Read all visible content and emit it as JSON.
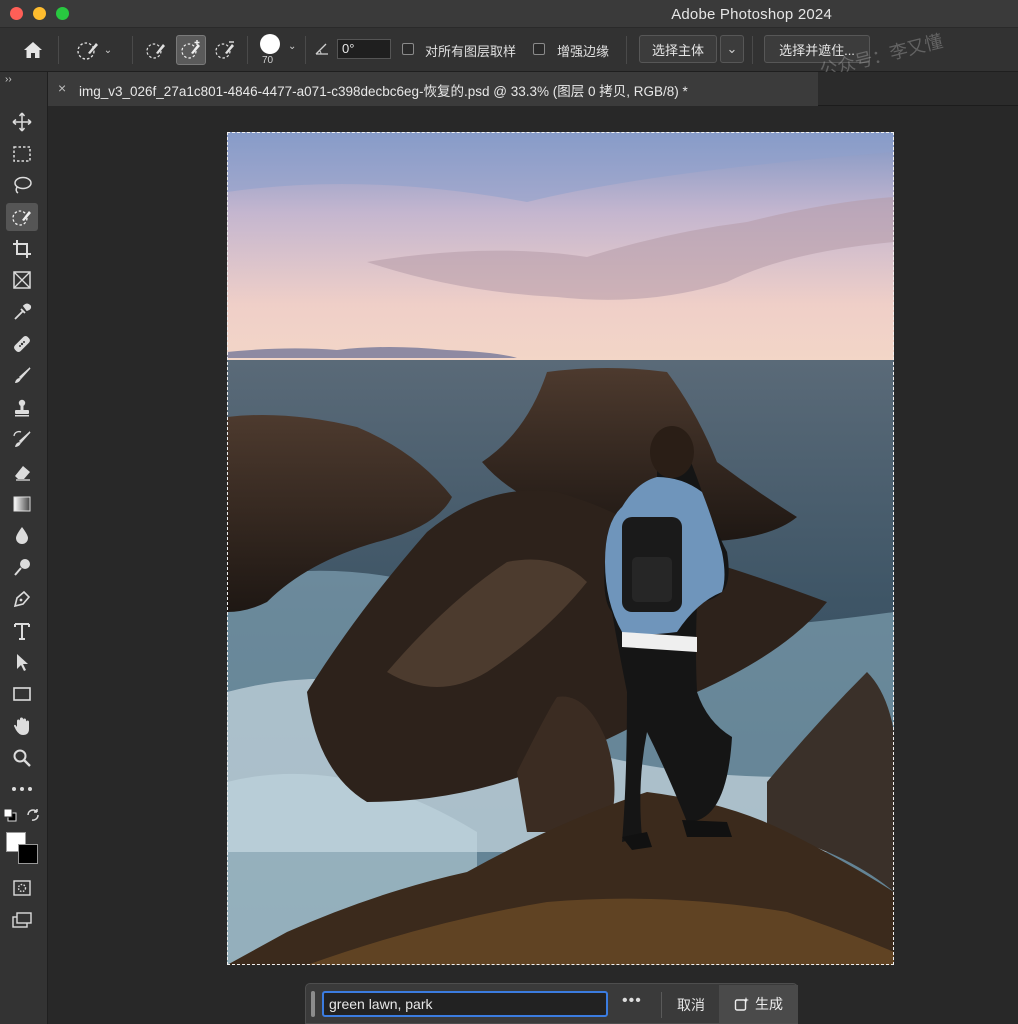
{
  "window": {
    "app_title": "Adobe Photoshop 2024"
  },
  "options": {
    "brush_size": "70",
    "angle_value": "0°",
    "sample_all_layers": "对所有图层取样",
    "enhance_edge": "增强边缘",
    "select_subject": "选择主体",
    "select_and_mask": "选择并遮住..."
  },
  "watermark": "公众号：李又懂",
  "toolbar": {
    "collapse": "››"
  },
  "tab": {
    "close": "×",
    "title": "img_v3_026f_27a1c801-4846-4477-a071-c398decbc6eg-恢复的.psd @ 33.3% (图层 0 拷贝, RGB/8) *"
  },
  "taskbar": {
    "prompt_value": "green lawn, park",
    "more": "•••",
    "cancel": "取消",
    "generate": "生成"
  }
}
